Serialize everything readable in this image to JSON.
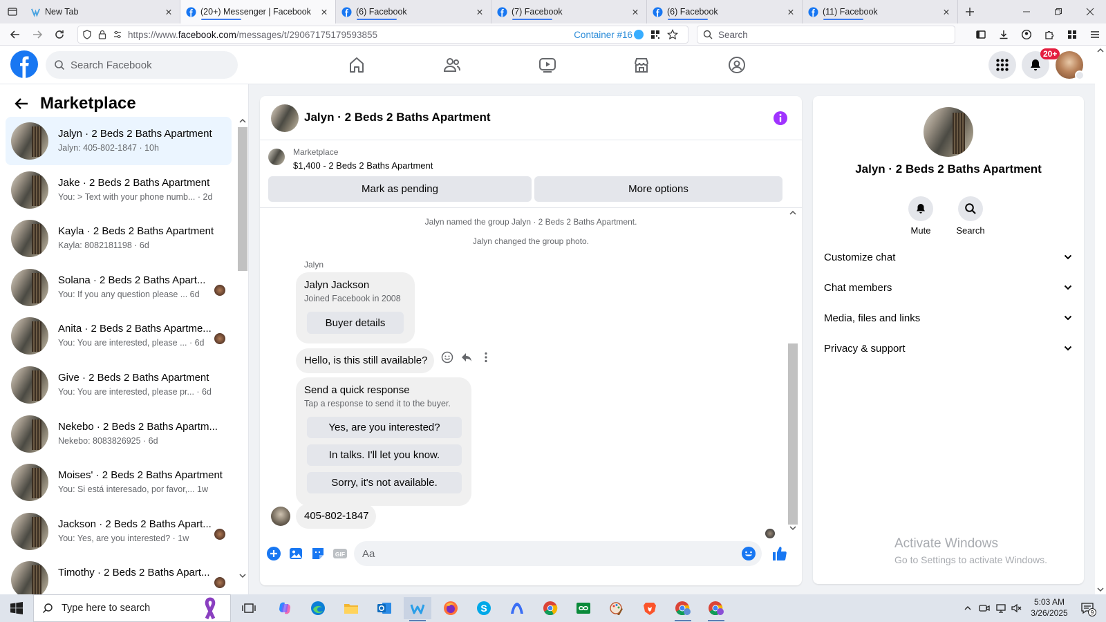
{
  "browser": {
    "tabs": [
      {
        "title": "New Tab",
        "active": false
      },
      {
        "title": "(20+) Messenger | Facebook",
        "active": true
      },
      {
        "title": "(6) Facebook",
        "active": false
      },
      {
        "title": "(7) Facebook",
        "active": false
      },
      {
        "title": "(6) Facebook",
        "active": false
      },
      {
        "title": "(11) Facebook",
        "active": false
      }
    ],
    "url_prefix": "https://www.",
    "url_host": "facebook.com",
    "url_path": "/messages/t/29067175179593855",
    "container_label": "Container #16",
    "search_placeholder": "Search"
  },
  "fb": {
    "search_placeholder": "Search Facebook",
    "notification_badge": "20+"
  },
  "sidebar": {
    "title": "Marketplace",
    "conversations": [
      {
        "name": "Jalyn · 2 Beds 2 Baths Apartment",
        "preview": "Jalyn: 405-802-1847 · 10h",
        "active": true,
        "mini": false
      },
      {
        "name": "Jake · 2 Beds 2 Baths Apartment",
        "preview": "You: > Text with your phone numb... · 2d",
        "active": false,
        "mini": false
      },
      {
        "name": "Kayla · 2 Beds 2 Baths Apartment",
        "preview": "Kayla: 8082181198 · 6d",
        "active": false,
        "mini": false
      },
      {
        "name": "Solana · 2 Beds 2 Baths Apart...",
        "preview": "You: If you any question please ...  6d",
        "active": false,
        "mini": true
      },
      {
        "name": "Anita · 2 Beds 2 Baths Apartme...",
        "preview": "You: You are interested, please ... · 6d",
        "active": false,
        "mini": true
      },
      {
        "name": "Give · 2 Beds 2 Baths Apartment",
        "preview": "You: You are interested, please pr...  · 6d",
        "active": false,
        "mini": false
      },
      {
        "name": "Nekebo · 2 Beds 2 Baths Apartm...",
        "preview": "Nekebo: 8083826925 · 6d",
        "active": false,
        "mini": false
      },
      {
        "name": "Moises' · 2 Beds 2 Baths Apartment",
        "preview": "You: Si está interesado, por favor,...  1w",
        "active": false,
        "mini": false
      },
      {
        "name": "Jackson · 2 Beds 2 Baths Apart...",
        "preview": "You: Yes, are you interested? · 1w",
        "active": false,
        "mini": true
      },
      {
        "name": "Timothy · 2 Beds 2 Baths Apart...",
        "preview": "",
        "active": false,
        "mini": true
      }
    ]
  },
  "chat": {
    "title": "Jalyn · 2 Beds 2 Baths Apartment",
    "marketplace_label": "Marketplace",
    "listing": "$1,400 - 2 Beds 2 Baths Apartment",
    "mark_pending_label": "Mark as pending",
    "more_options_label": "More options",
    "system_messages": [
      "Jalyn named the group Jalyn · 2 Beds 2 Baths Apartment.",
      "Jalyn changed the group photo."
    ],
    "sender": "Jalyn",
    "card_name": "Jalyn Jackson",
    "card_sub": "Joined Facebook in 2008",
    "buyer_details_label": "Buyer details",
    "message1": "Hello, is this still available?",
    "quick_title": "Send a quick response",
    "quick_sub": "Tap a response to send it to the buyer.",
    "quick_responses": [
      "Yes, are you interested?",
      "In talks. I'll let you know.",
      "Sorry, it's not available."
    ],
    "message2": "405-802-1847",
    "composer_placeholder": "Aa"
  },
  "info": {
    "title": "Jalyn · 2 Beds 2 Baths Apartment",
    "mute_label": "Mute",
    "search_label": "Search",
    "sections": [
      "Customize chat",
      "Chat members",
      "Media, files and links",
      "Privacy & support"
    ]
  },
  "watermark": {
    "line1": "Activate Windows",
    "line2": "Go to Settings to activate Windows."
  },
  "taskbar": {
    "search_placeholder": "Type here to search",
    "time": "5:03 AM",
    "date": "3/26/2025",
    "notif_count": "9"
  },
  "colors": {
    "fb_blue": "#1877f2",
    "messenger_purple": "#a033ff",
    "badge_red": "#e41e3f",
    "active_row": "#ebf5ff"
  }
}
